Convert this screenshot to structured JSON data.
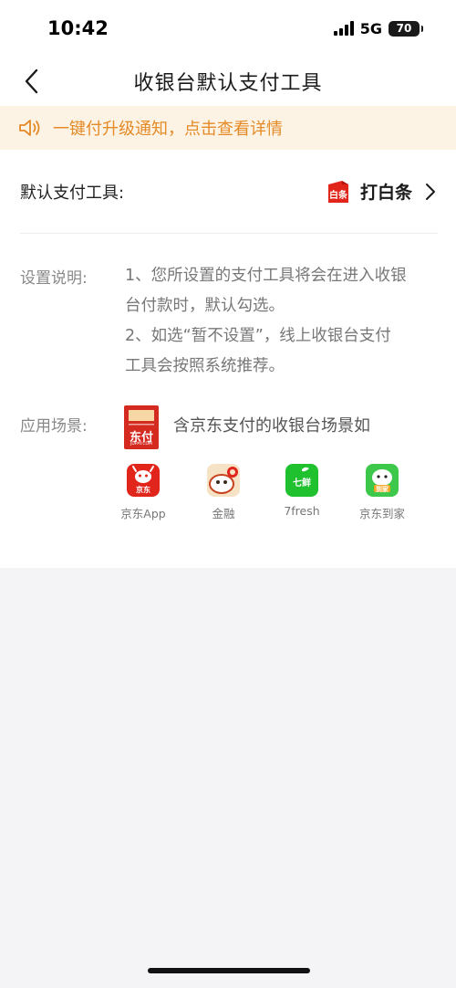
{
  "status_bar": {
    "time": "10:42",
    "network": "5G",
    "battery": "70"
  },
  "nav": {
    "title": "收银台默认支付工具",
    "back_icon": "chevron-left-icon"
  },
  "notice": {
    "icon": "speaker-icon",
    "text": "一键付升级通知，点击查看详情",
    "color": "#e48a27",
    "background": "#fdf3e4"
  },
  "default_pay": {
    "label": "默认支付工具:",
    "tool_icon_text": "白条",
    "tool_name": "打白条",
    "chevron_icon": "chevron-right-icon"
  },
  "description": {
    "label": "设置说明:",
    "lines": [
      "1、您所设置的支付工具将会在进入收银",
      "台付款时，默认勾选。",
      "2、如选“暂不设置”，线上收银台支付",
      "工具会按照系统推荐。"
    ]
  },
  "scene": {
    "label": "应用场景:",
    "logo_text": "东付",
    "logo_subtext": "JDPAY.COM",
    "text": "含京东支付的收银台场景如",
    "apps": [
      {
        "name": "京东App",
        "icon": "jd-app-icon",
        "badge": "京东"
      },
      {
        "name": "金融",
        "icon": "jd-finance-icon",
        "badge": ""
      },
      {
        "name": "7fresh",
        "icon": "7fresh-icon",
        "badge": "七鲜"
      },
      {
        "name": "京东到家",
        "icon": "jd-daojia-icon",
        "badge": "到家"
      }
    ]
  },
  "colors": {
    "accent_orange": "#e48a27",
    "jd_red": "#e1251b",
    "fresh_green": "#1fc12f",
    "daojia_green": "#3ec84b"
  }
}
